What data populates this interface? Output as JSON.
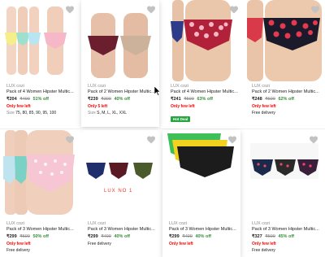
{
  "colors": {
    "price_green": "#388e3c",
    "stock_red": "#ff0000",
    "hot_deal_green": "#26a541",
    "heart_gray": "#c2c2c2"
  },
  "products": [
    {
      "brand": "LUX cozi",
      "title": "Pack of 4 Women Hipster Multic...",
      "price": "₹204",
      "mrp": "₹499",
      "off": "51% off",
      "stock": "Only few left",
      "sizes_label": "Size",
      "sizes": "75, 80, 85, 90, 95, 100",
      "icon": "heart-icon"
    },
    {
      "brand": "LUX cozi",
      "title": "Pack of 2 Women Hipster Multic...",
      "price": "₹239",
      "mrp": "₹399",
      "off": "40% off",
      "stock": "Only 5 left",
      "sizes_label": "Size",
      "sizes": "S, M, L, XL, XXL",
      "icon": "heart-icon"
    },
    {
      "brand": "LUX cozi",
      "title": "Pack of 4 Women Hipster Multic...",
      "price": "₹241",
      "mrp": "₹599",
      "off": "63% off",
      "stock": "Only few left",
      "badge": "Hot Deal",
      "icon": "heart-icon"
    },
    {
      "brand": "LUX cozi",
      "title": "Pack of 2 Women Hipster Multic...",
      "price": "₹248",
      "mrp": "₹599",
      "off": "62% off",
      "stock": "Only few left",
      "delivery": "Free delivery",
      "icon": "heart-icon"
    },
    {
      "brand": "LUX cozi",
      "title": "Pack of 3 Women Hipster Multic...",
      "price": "₹299",
      "mrp": "₹599",
      "off": "50% off",
      "stock": "Only few left",
      "delivery": "Free delivery",
      "icon": "heart-icon"
    },
    {
      "brand": "LUX cozi",
      "title": "Pack of 3 Women Hipster Multic...",
      "price": "₹299",
      "mrp": "₹499",
      "off": "40% off",
      "delivery": "Free delivery",
      "overlay": "LUX NO 1",
      "icon": "heart-icon"
    },
    {
      "brand": "LUX cozi",
      "title": "Pack of 3 Women Hipster Multic...",
      "price": "₹299",
      "mrp": "₹499",
      "off": "40% off",
      "stock": "Only few left",
      "icon": "heart-icon"
    },
    {
      "brand": "LUX cozi",
      "title": "Pack of 3 Women Hipster Multic...",
      "price": "₹327",
      "mrp": "₹599",
      "off": "45% off",
      "stock": "Only few left",
      "delivery": "Free delivery",
      "icon": "heart-icon"
    }
  ]
}
